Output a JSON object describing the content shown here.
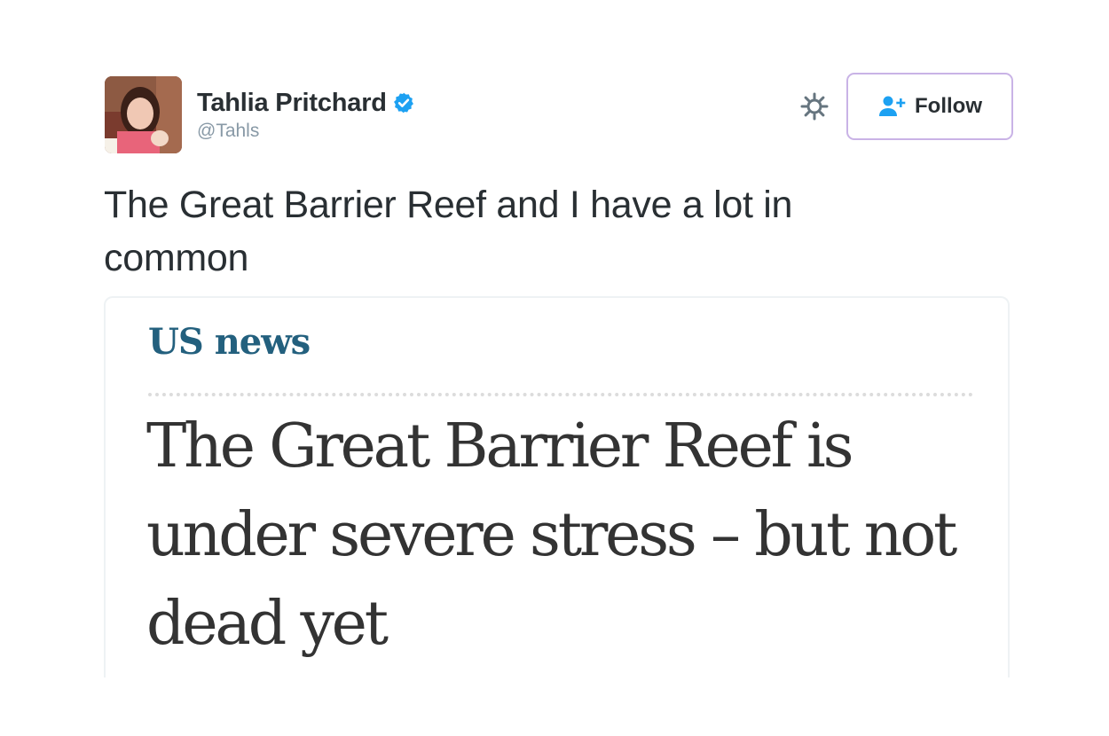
{
  "tweet": {
    "author": {
      "display_name": "Tahlia Pritchard",
      "handle": "@Tahls",
      "verified": true,
      "avatar_icon": "profile-photo"
    },
    "actions": {
      "settings_icon": "gear-icon",
      "follow_label": "Follow",
      "follow_icon": "add-user-icon",
      "follow_border_color": "#c9b3e6"
    },
    "text": "The Great Barrier Reef and I have a lot in common",
    "media": {
      "section_label": "US news",
      "headline": "The Great Barrier Reef is under severe stress – but not dead yet"
    }
  },
  "colors": {
    "verified_blue": "#1da1f2",
    "section_blue": "#23607e",
    "text_dark": "#292f33",
    "text_muted": "#8899a6"
  }
}
